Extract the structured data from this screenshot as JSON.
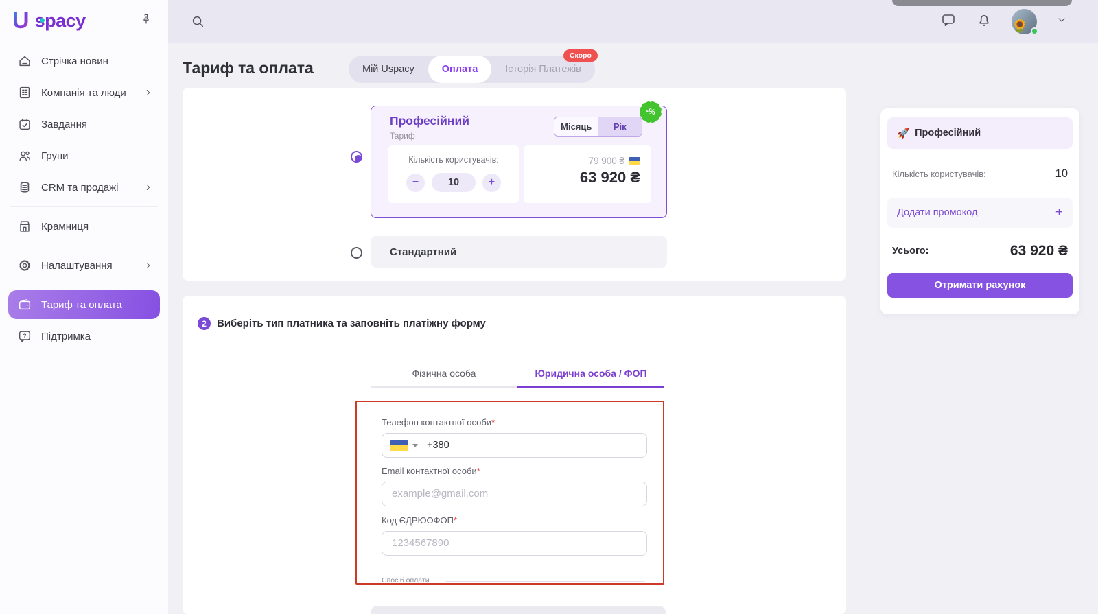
{
  "brand": {
    "logo_u": "U",
    "logo_rest": "spacy"
  },
  "sidebar": {
    "items": [
      {
        "label": "Стрічка новин"
      },
      {
        "label": "Компанія та люди"
      },
      {
        "label": "Завдання"
      },
      {
        "label": "Групи"
      },
      {
        "label": "CRM та продажі"
      },
      {
        "label": "Крамниця"
      },
      {
        "label": "Налаштування"
      },
      {
        "label": "Тариф та оплата"
      },
      {
        "label": "Підтримка"
      }
    ]
  },
  "header": {
    "title": "Тариф та оплата",
    "tabs": [
      {
        "label": "Мій Uspacy"
      },
      {
        "label": "Оплата"
      },
      {
        "label": "Історія Платежів",
        "badge": "Скоро"
      }
    ]
  },
  "plan_selector": {
    "selected_plan": {
      "name": "Професійний",
      "subtitle": "Тариф",
      "billing_options": [
        "Місяць",
        "Рік"
      ],
      "billing_selected": "Рік",
      "discount_badge": "-%",
      "users_label": "Кількість користувачів:",
      "users_value": "10",
      "stepper": {
        "decrease": "−",
        "increase": "+"
      },
      "old_price": "79 900 ₴",
      "price": "63 920 ₴",
      "flag_icon": "ukraine-flag"
    },
    "other_plan": {
      "name": "Стандартний"
    }
  },
  "payer_form": {
    "step_number": "2",
    "title": "Виберіть тип платника та заповніть платіжну форму",
    "tabs": [
      {
        "label": "Фізична особа"
      },
      {
        "label": "Юридична особа / ФОП"
      }
    ],
    "fields": {
      "phone": {
        "label": "Телефон контактної особи",
        "required": "*",
        "value": "+380"
      },
      "email": {
        "label": "Email контактної особи",
        "required": "*",
        "placeholder": "example@gmail.com"
      },
      "edrpou": {
        "label": "Код ЄДРЮОФОП",
        "required": "*",
        "placeholder": "1234567890"
      }
    },
    "payment_method_label": "Спосіб оплати"
  },
  "summary": {
    "plan_icon": "🚀",
    "plan_name": "Професійний",
    "users_label": "Кількість користувачів:",
    "users_value": "10",
    "promo_label": "Додати промокод",
    "promo_plus": "+",
    "total_label": "Усього:",
    "total_value": "63 920 ₴",
    "button_label": "Отримати рахунок"
  },
  "colors": {
    "accent": "#7a49d5",
    "active_gradient": [
      "#a97de9",
      "#8650e2"
    ],
    "badge_red": "#ef5050",
    "badge_green": "#43c32e",
    "form_highlight_border": "#cc3a28",
    "flag_blue": "#3f5fb5",
    "flag_yellow": "#ffd94a"
  }
}
